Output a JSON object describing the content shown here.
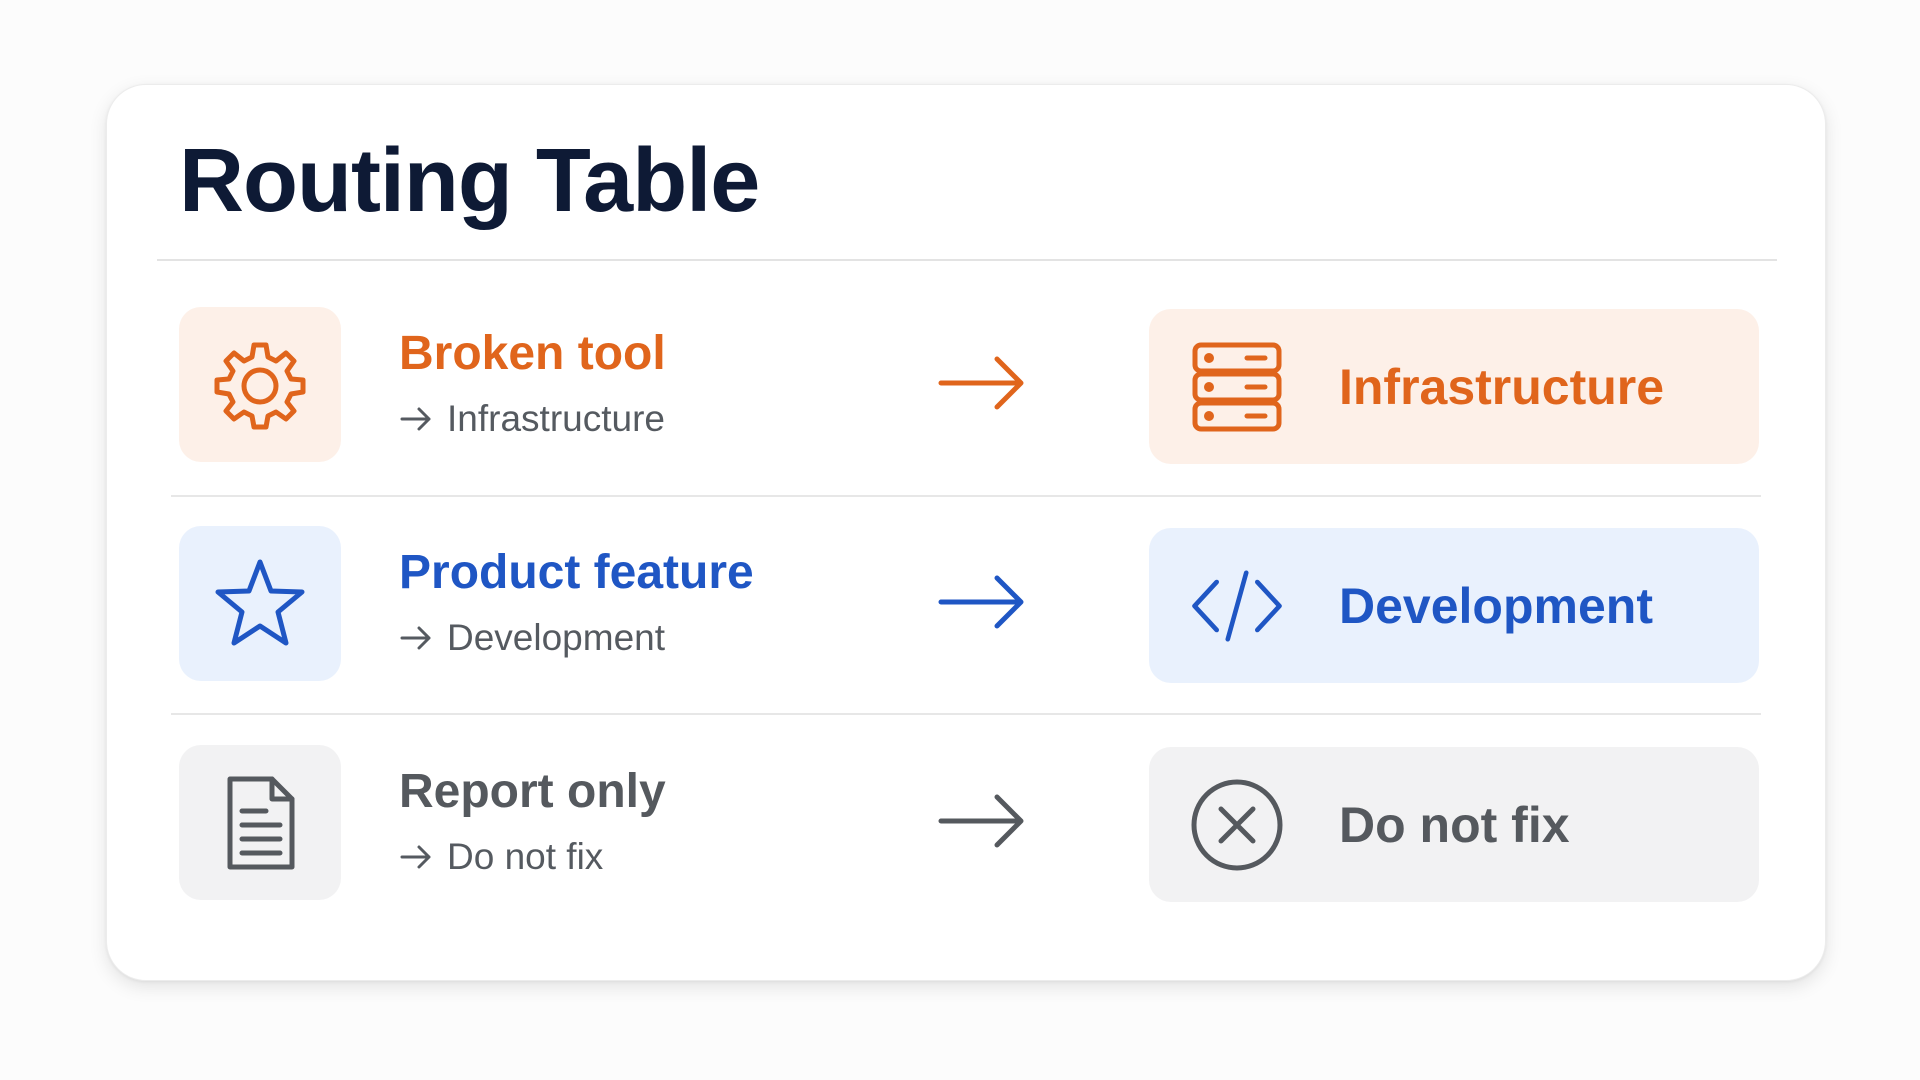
{
  "title": "Routing Table",
  "colors": {
    "orange": "#e0651c",
    "orange_bg": "#fdf0e8",
    "blue": "#1f56c4",
    "blue_bg": "#e9f1fd",
    "gray": "#55595e",
    "gray_bg": "#f2f2f3"
  },
  "rows": [
    {
      "icon": "gear-icon",
      "label": "Broken tool",
      "sub": "Infrastructure",
      "destination": "Infrastructure",
      "destination_icon": "server-icon"
    },
    {
      "icon": "star-icon",
      "label": "Product feature",
      "sub": "Development",
      "destination": "Development",
      "destination_icon": "code-icon"
    },
    {
      "icon": "document-icon",
      "label": "Report only",
      "sub": "Do not fix",
      "destination": "Do not fix",
      "destination_icon": "x-circle-icon"
    }
  ]
}
